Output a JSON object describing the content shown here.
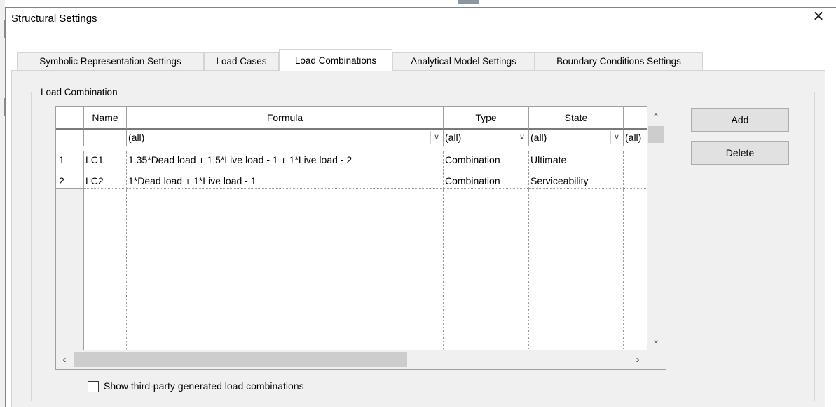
{
  "window": {
    "title": "Structural Settings",
    "close_icon": "close-icon"
  },
  "tabs": [
    {
      "label": "Symbolic Representation Settings",
      "active": false
    },
    {
      "label": "Load Cases",
      "active": false
    },
    {
      "label": "Load Combinations",
      "active": true
    },
    {
      "label": "Analytical Model Settings",
      "active": false
    },
    {
      "label": "Boundary Conditions Settings",
      "active": false
    }
  ],
  "group": {
    "label": "Load Combination"
  },
  "table": {
    "headers": [
      "Name",
      "Formula",
      "Type",
      "State"
    ],
    "filters": [
      "(all)",
      "(all)",
      "(all)",
      "(all)"
    ],
    "rows": [
      {
        "index": "1",
        "name": "LC1",
        "formula": "1.35*Dead load + 1.5*Live load - 1 + 1*Live load - 2",
        "type": "Combination",
        "state": "Ultimate"
      },
      {
        "index": "2",
        "name": "LC2",
        "formula": "1*Dead load + 1*Live load - 1",
        "type": "Combination",
        "state": "Serviceability"
      }
    ],
    "scroll_up_icon": "chevron-up-icon",
    "scroll_down_icon": "chevron-down-icon",
    "scroll_left_icon": "chevron-left-icon",
    "scroll_right_icon": "chevron-right-icon",
    "dropdown_icon": "chevron-down-icon"
  },
  "buttons": {
    "add": "Add",
    "delete": "Delete"
  },
  "checkbox": {
    "label": "Show third-party generated load combinations",
    "checked": false
  },
  "colors": {
    "window_border": "#2f9fd8",
    "panel_bg": "#f0f0f0",
    "button_bg": "#e1e1e1"
  }
}
